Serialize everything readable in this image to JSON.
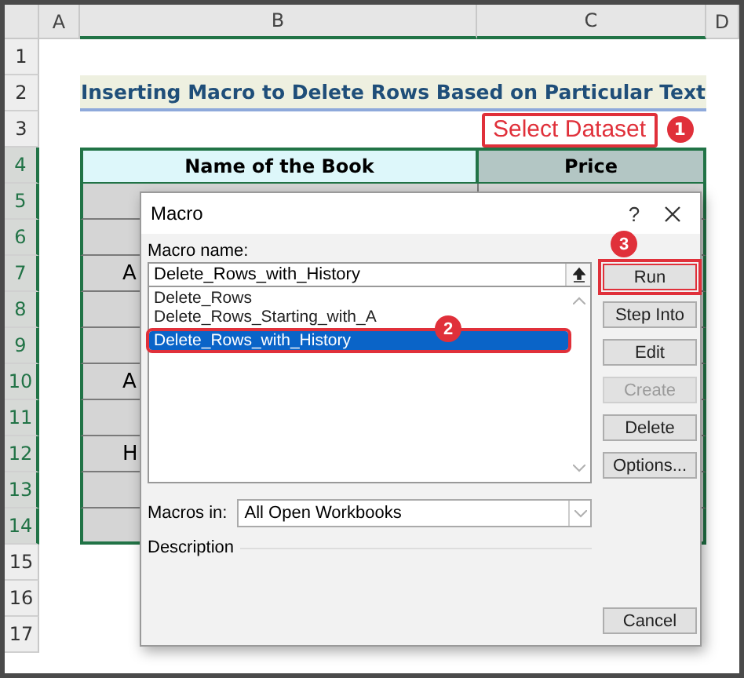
{
  "sheet": {
    "column_headers": [
      "A",
      "B",
      "C",
      "D"
    ],
    "row_headers": [
      "1",
      "2",
      "3",
      "4",
      "5",
      "6",
      "7",
      "8",
      "9",
      "10",
      "11",
      "12",
      "13",
      "14",
      "15",
      "16",
      "17"
    ],
    "title": "Inserting Macro to Delete Rows Based on Particular Text",
    "callout": {
      "label": "Select Dataset",
      "step": "1"
    },
    "table": {
      "columns": [
        "Name of the Book",
        "Price"
      ],
      "rows": [
        {},
        {},
        {
          "book": "A"
        },
        {},
        {},
        {
          "book": "A"
        },
        {},
        {
          "book": "H"
        },
        {},
        {}
      ]
    }
  },
  "dialog": {
    "title": "Macro",
    "help": "?",
    "macro_name_label": "Macro name:",
    "macro_name_value": "Delete_Rows_with_History",
    "macros": [
      {
        "name": "Delete_Rows",
        "selected": false
      },
      {
        "name": "Delete_Rows_Starting_with_A",
        "selected": false
      },
      {
        "name": "Delete_Rows_with_History",
        "selected": true,
        "highlighted": true,
        "step": "2"
      }
    ],
    "buttons": [
      {
        "label": "Run",
        "disabled": false,
        "highlighted": true,
        "step": "3"
      },
      {
        "label": "Step Into",
        "disabled": false
      },
      {
        "label": "Edit",
        "disabled": false
      },
      {
        "label": "Create",
        "disabled": true
      },
      {
        "label": "Delete",
        "disabled": false
      },
      {
        "label": "Options...",
        "disabled": false
      }
    ],
    "macros_in_label": "Macros in:",
    "macros_in_value": "All Open Workbooks",
    "description_label": "Description",
    "cancel": "Cancel"
  }
}
